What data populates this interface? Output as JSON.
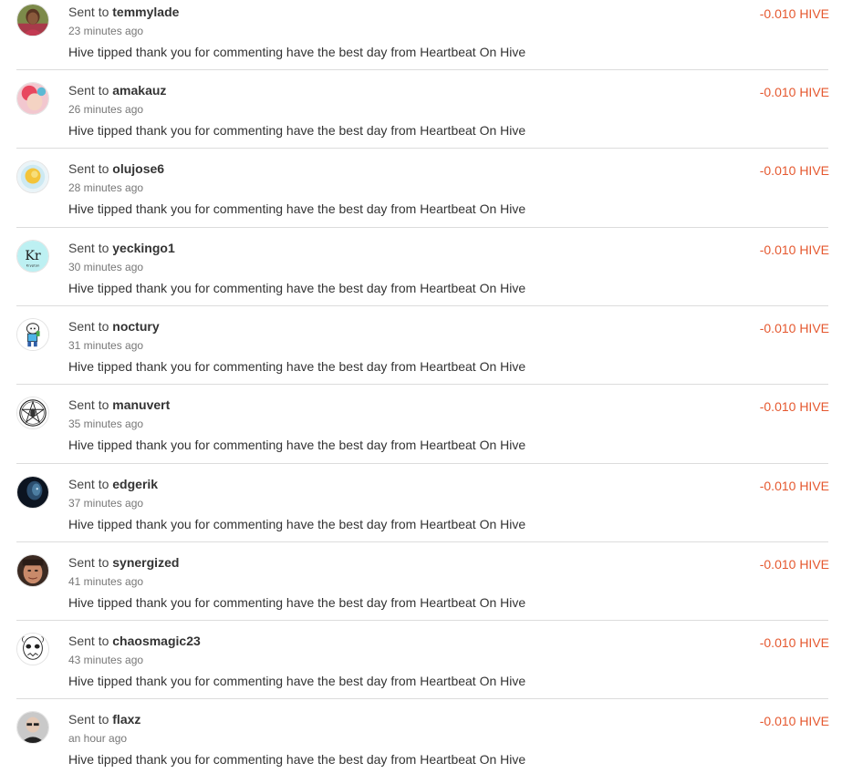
{
  "transfers": [
    {
      "prefix": "Sent to",
      "user": "temmylade",
      "time": "23 minutes ago",
      "memo": "Hive tipped thank you for commenting have the best day from Heartbeat On Hive",
      "amount": "-0.010 HIVE",
      "avatar": "photo-avatar"
    },
    {
      "prefix": "Sent to",
      "user": "amakauz",
      "time": "26 minutes ago",
      "memo": "Hive tipped thank you for commenting have the best day from Heartbeat On Hive",
      "amount": "-0.010 HIVE",
      "avatar": "pink-avatar"
    },
    {
      "prefix": "Sent to",
      "user": "olujose6",
      "time": "28 minutes ago",
      "memo": "Hive tipped thank you for commenting have the best day from Heartbeat On Hive",
      "amount": "-0.010 HIVE",
      "avatar": "sun-avatar"
    },
    {
      "prefix": "Sent to",
      "user": "yeckingo1",
      "time": "30 minutes ago",
      "memo": "Hive tipped thank you for commenting have the best day from Heartbeat On Hive",
      "amount": "-0.010 HIVE",
      "avatar": "krypton-avatar"
    },
    {
      "prefix": "Sent to",
      "user": "noctury",
      "time": "31 minutes ago",
      "memo": "Hive tipped thank you for commenting have the best day from Heartbeat On Hive",
      "amount": "-0.010 HIVE",
      "avatar": "cartoon-avatar"
    },
    {
      "prefix": "Sent to",
      "user": "manuvert",
      "time": "35 minutes ago",
      "memo": "Hive tipped thank you for commenting have the best day from Heartbeat On Hive",
      "amount": "-0.010 HIVE",
      "avatar": "pentagram-avatar"
    },
    {
      "prefix": "Sent to",
      "user": "edgerik",
      "time": "37 minutes ago",
      "memo": "Hive tipped thank you for commenting have the best day from Heartbeat On Hive",
      "amount": "-0.010 HIVE",
      "avatar": "dark-avatar"
    },
    {
      "prefix": "Sent to",
      "user": "synergized",
      "time": "41 minutes ago",
      "memo": "Hive tipped thank you for commenting have the best day from Heartbeat On Hive",
      "amount": "-0.010 HIVE",
      "avatar": "face-avatar"
    },
    {
      "prefix": "Sent to",
      "user": "chaosmagic23",
      "time": "43 minutes ago",
      "memo": "Hive tipped thank you for commenting have the best day from Heartbeat On Hive",
      "amount": "-0.010 HIVE",
      "avatar": "sketch-avatar"
    },
    {
      "prefix": "Sent to",
      "user": "flaxz",
      "time": "an hour ago",
      "memo": "Hive tipped thank you for commenting have the best day from Heartbeat On Hive",
      "amount": "-0.010 HIVE",
      "avatar": "grey-avatar"
    }
  ],
  "avatar_text": {
    "krypton_symbol": "Kr",
    "krypton_name": "Krypton"
  },
  "colors": {
    "amount": "#e5582f",
    "separator": "#dcdcdc"
  }
}
